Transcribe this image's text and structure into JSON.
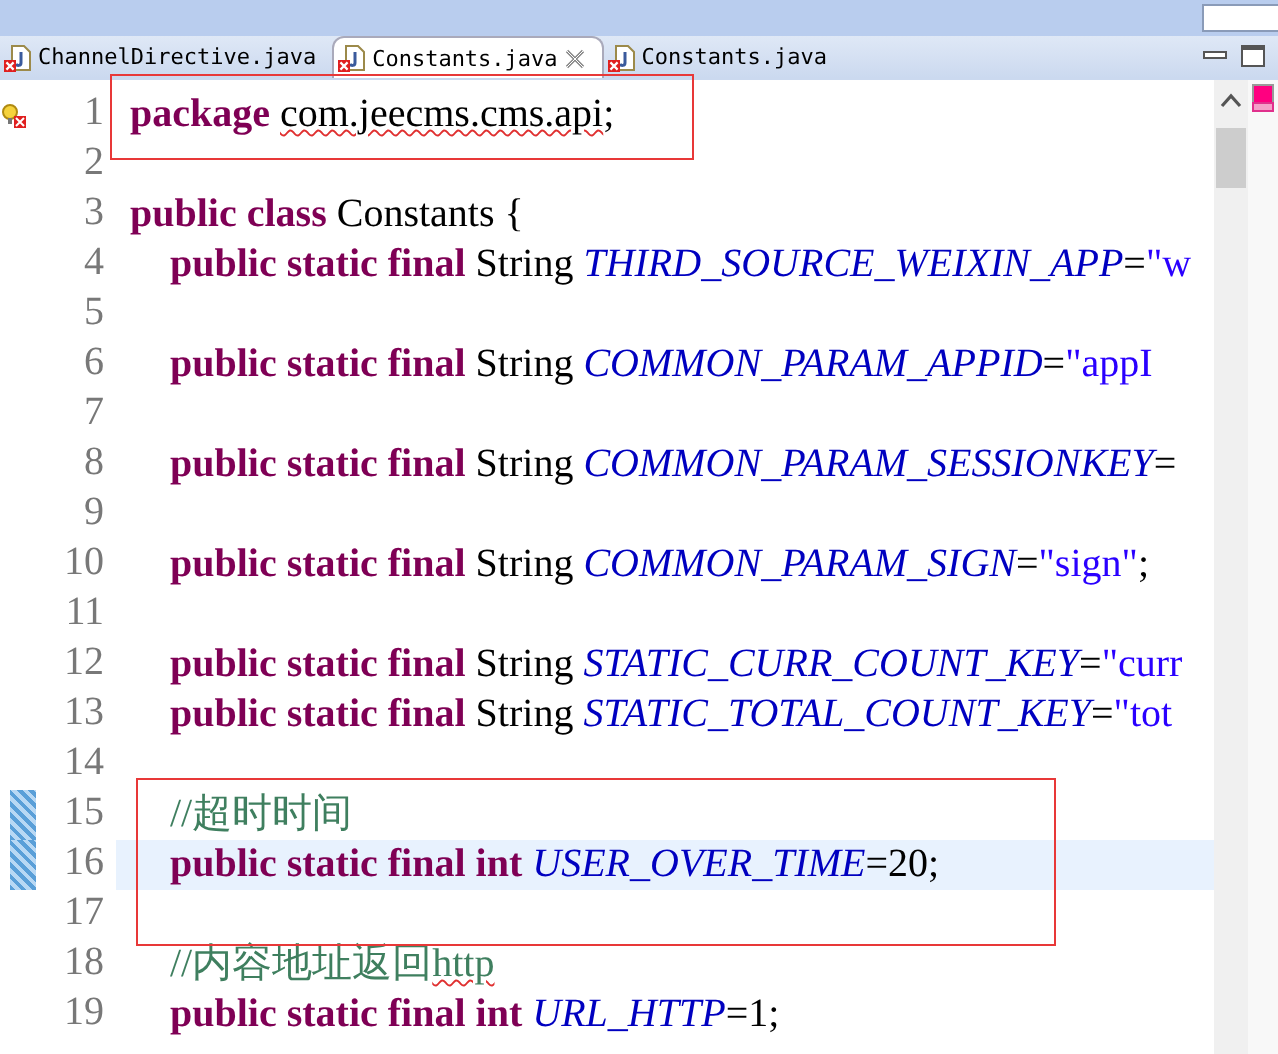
{
  "tabs": [
    {
      "label": "ChannelDirective.java",
      "selected": false,
      "error": true
    },
    {
      "label": "Constants.java",
      "selected": true,
      "error": true,
      "closable": true
    },
    {
      "label": "Constants.java",
      "selected": false,
      "error": true
    }
  ],
  "editor": {
    "lines": [
      {
        "number": "1",
        "problem": true,
        "boxed": true,
        "tokens": [
          {
            "kind": "keyword",
            "text": "package "
          },
          {
            "kind": "plain",
            "text": "com.jeecms.cms.api",
            "squiggle": true
          },
          {
            "kind": "plain",
            "text": ";"
          }
        ]
      },
      {
        "number": "2"
      },
      {
        "number": "3",
        "tokens": [
          {
            "kind": "keyword",
            "text": "public class"
          },
          {
            "kind": "plain",
            "text": " Constants {"
          }
        ]
      },
      {
        "number": "4",
        "indent": true,
        "tokens": [
          {
            "kind": "keyword",
            "text": "public static final"
          },
          {
            "kind": "plain",
            "text": " String "
          },
          {
            "kind": "constant",
            "text": "THIRD_SOURCE_WEIXIN_APP"
          },
          {
            "kind": "plain",
            "text": "="
          },
          {
            "kind": "string",
            "text": "\"w"
          }
        ]
      },
      {
        "number": "5"
      },
      {
        "number": "6",
        "indent": true,
        "tokens": [
          {
            "kind": "keyword",
            "text": "public static final"
          },
          {
            "kind": "plain",
            "text": " String "
          },
          {
            "kind": "constant",
            "text": "COMMON_PARAM_APPID"
          },
          {
            "kind": "plain",
            "text": "="
          },
          {
            "kind": "string",
            "text": "\"appI"
          }
        ]
      },
      {
        "number": "7"
      },
      {
        "number": "8",
        "indent": true,
        "tokens": [
          {
            "kind": "keyword",
            "text": "public static final"
          },
          {
            "kind": "plain",
            "text": " String "
          },
          {
            "kind": "constant",
            "text": "COMMON_PARAM_SESSIONKEY"
          },
          {
            "kind": "plain",
            "text": "="
          }
        ]
      },
      {
        "number": "9"
      },
      {
        "number": "10",
        "indent": true,
        "tokens": [
          {
            "kind": "keyword",
            "text": "public static final"
          },
          {
            "kind": "plain",
            "text": " String "
          },
          {
            "kind": "constant",
            "text": "COMMON_PARAM_SIGN"
          },
          {
            "kind": "plain",
            "text": "="
          },
          {
            "kind": "string",
            "text": "\"sign\""
          },
          {
            "kind": "plain",
            "text": ";"
          }
        ]
      },
      {
        "number": "11"
      },
      {
        "number": "12",
        "indent": true,
        "tokens": [
          {
            "kind": "keyword",
            "text": "public static final"
          },
          {
            "kind": "plain",
            "text": " String "
          },
          {
            "kind": "constant",
            "text": "STATIC_CURR_COUNT_KEY"
          },
          {
            "kind": "plain",
            "text": "="
          },
          {
            "kind": "string",
            "text": "\"curr"
          }
        ]
      },
      {
        "number": "13",
        "indent": true,
        "tokens": [
          {
            "kind": "keyword",
            "text": "public static final"
          },
          {
            "kind": "plain",
            "text": " String "
          },
          {
            "kind": "constant",
            "text": "STATIC_TOTAL_COUNT_KEY"
          },
          {
            "kind": "plain",
            "text": "="
          },
          {
            "kind": "string",
            "text": "\"tot"
          }
        ]
      },
      {
        "number": "14"
      },
      {
        "number": "15",
        "indent": true,
        "changed": true,
        "boxed": true,
        "tokens": [
          {
            "kind": "comment",
            "text": "//超时时间"
          }
        ]
      },
      {
        "number": "16",
        "indent": true,
        "current": true,
        "changed": true,
        "boxed": true,
        "tokens": [
          {
            "kind": "keyword",
            "text": "public static final int "
          },
          {
            "kind": "constant",
            "text": "USER_OVER_TIME"
          },
          {
            "kind": "plain",
            "text": "=20;"
          }
        ]
      },
      {
        "number": "17",
        "boxed": true
      },
      {
        "number": "18",
        "indent": true,
        "tokens": [
          {
            "kind": "comment",
            "text": "//内容地址返回"
          },
          {
            "kind": "comment",
            "text": "http",
            "squiggle": true
          }
        ]
      },
      {
        "number": "19",
        "indent": true,
        "tokens": [
          {
            "kind": "keyword",
            "text": "public static final int "
          },
          {
            "kind": "constant",
            "text": "URL_HTTP"
          },
          {
            "kind": "plain",
            "text": "=1;"
          }
        ]
      }
    ]
  }
}
